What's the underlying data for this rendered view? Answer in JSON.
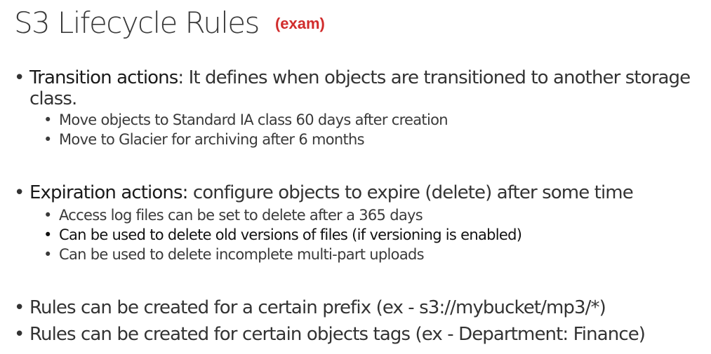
{
  "title": "S3 Lifecycle Rules",
  "badge": "(exam)",
  "colors": {
    "text": "#333333",
    "badge": "#d12c2c"
  },
  "transition": {
    "label": "Transition actions",
    "text_line1": ": It defines when objects are transitioned to another storage",
    "text_line2": "class.",
    "subs": [
      "Move objects to Standard IA class 60 days after creation",
      "Move to Glacier for archiving after 6 months"
    ]
  },
  "expiration": {
    "label": "Expiration actions:",
    "text": " configure objects to expire (delete) after some time",
    "subs": [
      "Access log files can be set to delete after a 365 days",
      "Can be used to delete old versions of files (if versioning is enabled)",
      "Can be used to delete incomplete multi-part uploads"
    ]
  },
  "rules": [
    "Rules can be created for a certain prefix (ex - s3://mybucket/mp3/*)",
    "Rules can be created for certain objects tags (ex - Department: Finance)"
  ],
  "bullet_glyph": "•"
}
